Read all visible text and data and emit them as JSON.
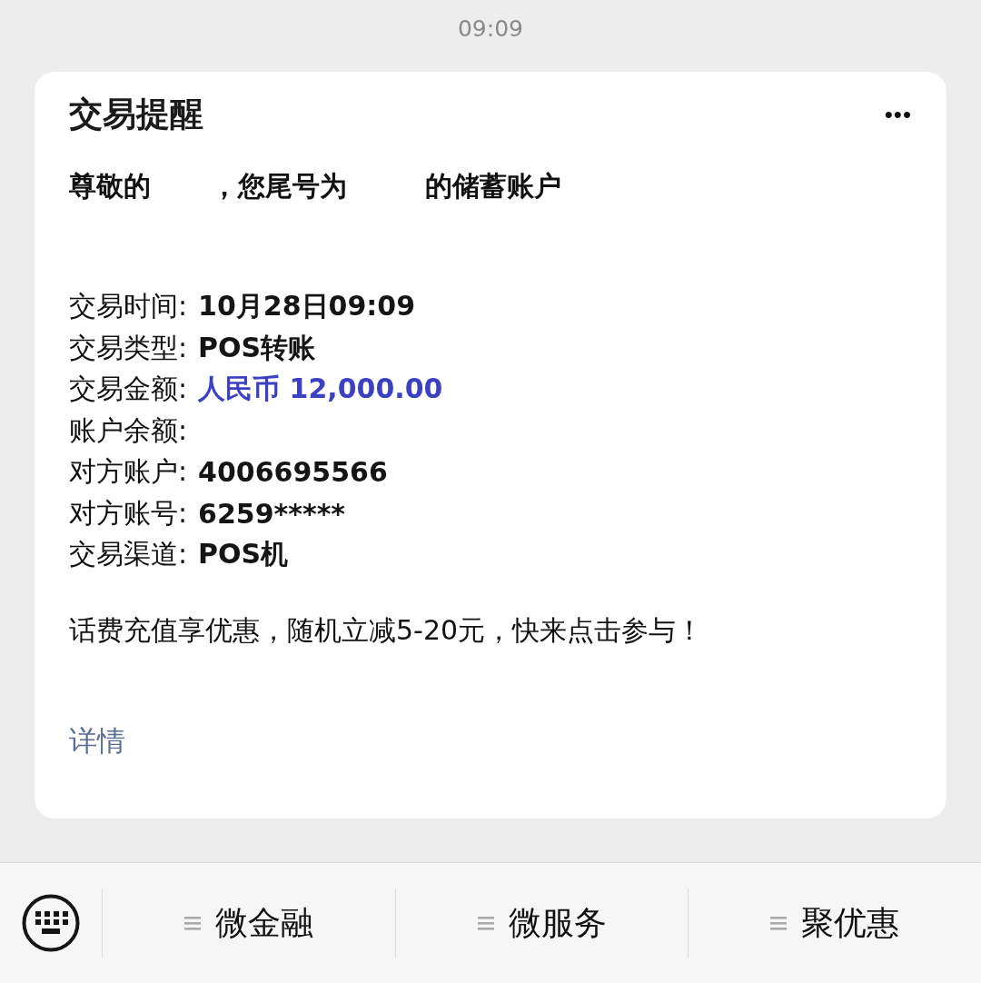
{
  "time": "09:09",
  "card": {
    "title": "交易提醒",
    "more": "•••",
    "greeting": [
      "尊敬的",
      "，您尾号为",
      "的储蓄账户"
    ],
    "fields": [
      {
        "label": "交易时间:",
        "value": "10月28日09:09",
        "kind": "text"
      },
      {
        "label": "交易类型:",
        "value": "POS转账",
        "kind": "text"
      },
      {
        "label": "交易金额:",
        "value": "人民币 12,000.00",
        "kind": "amount"
      },
      {
        "label": "账户余额:",
        "kind": "text"
      },
      {
        "label": "对方账户:",
        "value": "4006695566",
        "kind": "text"
      },
      {
        "label": "对方账号:",
        "value": "6259*****",
        "kind": "text"
      },
      {
        "label": "交易渠道:",
        "value": "POS机",
        "kind": "text"
      }
    ],
    "promo": "话费充值享优惠，随机立减5-20元，快来点击参与！",
    "details_link": "详情"
  },
  "menu_bar": {
    "items": [
      "微金融",
      "微服务",
      "聚优惠"
    ]
  }
}
